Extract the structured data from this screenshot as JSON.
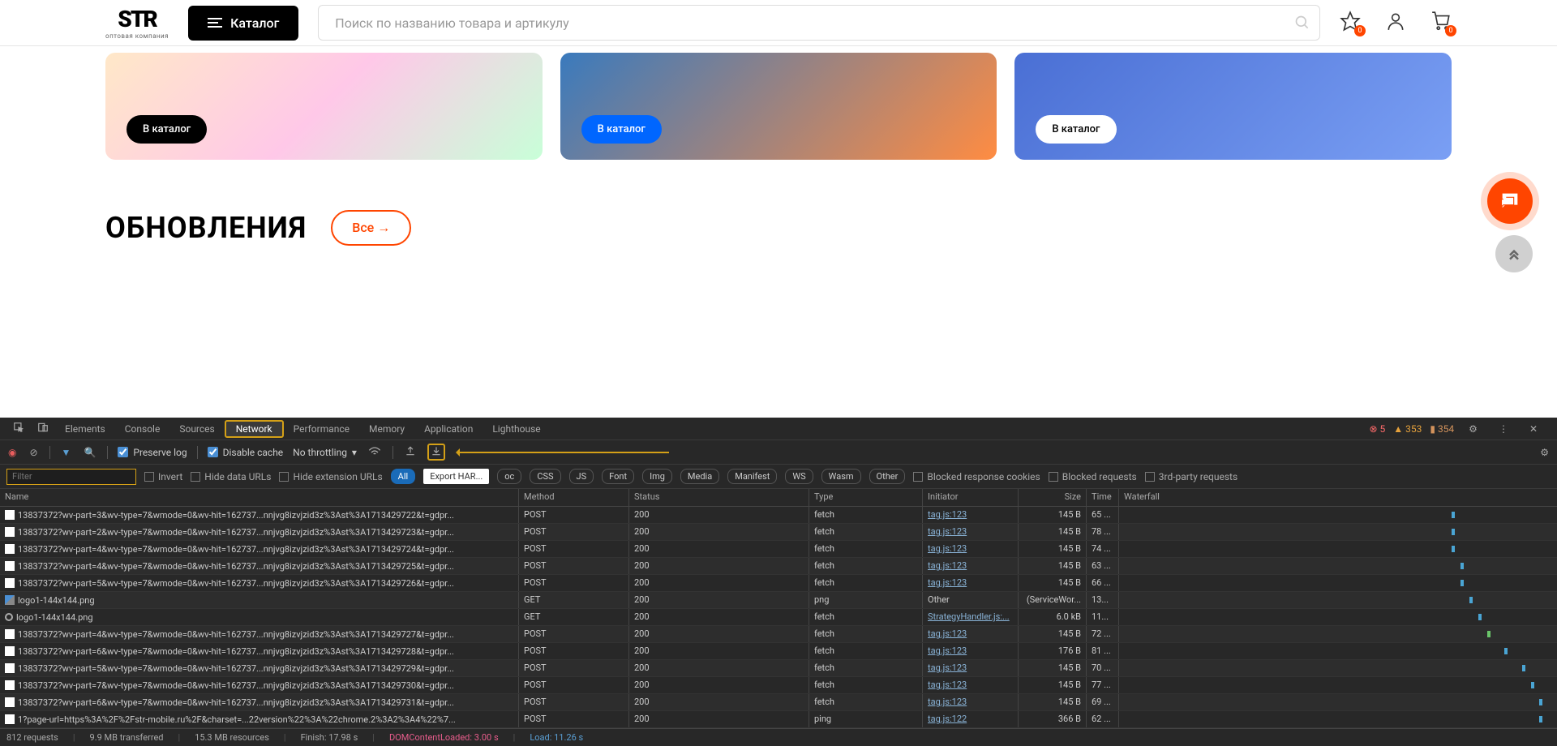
{
  "header": {
    "logo_main": "STR",
    "logo_sub": "оптовая компания",
    "catalog_btn": "Каталог",
    "search_placeholder": "Поиск по названию товара и артикулу",
    "fav_badge": "0",
    "cart_badge": "0"
  },
  "banners": [
    {
      "btn": "В каталог"
    },
    {
      "btn": "В каталог"
    },
    {
      "btn": "В каталог"
    }
  ],
  "section": {
    "title": "ОБНОВЛЕНИЯ",
    "all_btn": "Все →"
  },
  "devtools": {
    "tabs": [
      "Elements",
      "Console",
      "Sources",
      "Network",
      "Performance",
      "Memory",
      "Application",
      "Lighthouse"
    ],
    "active_tab": "Network",
    "errors": "5",
    "warnings": "353",
    "issues": "354",
    "toolbar": {
      "preserve_log": "Preserve log",
      "disable_cache": "Disable cache",
      "throttling": "No throttling"
    },
    "export_tooltip": "Export HAR...",
    "filter": {
      "placeholder": "Filter",
      "invert": "Invert",
      "hide_data": "Hide data URLs",
      "hide_ext": "Hide extension URLs",
      "chips": [
        "All",
        "oc",
        "CSS",
        "JS",
        "Font",
        "Img",
        "Media",
        "Manifest",
        "WS",
        "Wasm",
        "Other"
      ],
      "blocked_cookies": "Blocked response cookies",
      "blocked_requests": "Blocked requests",
      "third_party": "3rd-party requests"
    },
    "headers": {
      "name": "Name",
      "method": "Method",
      "status": "Status",
      "type": "Type",
      "initiator": "Initiator",
      "size": "Size",
      "time": "Time",
      "waterfall": "Waterfall"
    },
    "rows": [
      {
        "icon": "doc",
        "name": "13837372?wv-part=3&wv-type=7&wmode=0&wv-hit=162737...nnjvg8izvjzid3z%3Ast%3A1713429722&t=gdpr...",
        "method": "POST",
        "status": "200",
        "type": "fetch",
        "initiator": "tag.js:123",
        "initiator_link": true,
        "size": "145 B",
        "time": "65 ...",
        "wf": "at-76"
      },
      {
        "icon": "doc",
        "name": "13837372?wv-part=2&wv-type=7&wmode=0&wv-hit=162737...nnjvg8izvjzid3z%3Ast%3A1713429723&t=gdpr...",
        "method": "POST",
        "status": "200",
        "type": "fetch",
        "initiator": "tag.js:123",
        "initiator_link": true,
        "size": "145 B",
        "time": "78 ...",
        "wf": "at-76"
      },
      {
        "icon": "doc",
        "name": "13837372?wv-part=4&wv-type=7&wmode=0&wv-hit=162737...nnjvg8izvjzid3z%3Ast%3A1713429724&t=gdpr...",
        "method": "POST",
        "status": "200",
        "type": "fetch",
        "initiator": "tag.js:123",
        "initiator_link": true,
        "size": "145 B",
        "time": "74 ...",
        "wf": "at-76"
      },
      {
        "icon": "doc",
        "name": "13837372?wv-part=4&wv-type=7&wmode=0&wv-hit=162737...nnjvg8izvjzid3z%3Ast%3A1713429725&t=gdpr...",
        "method": "POST",
        "status": "200",
        "type": "fetch",
        "initiator": "tag.js:123",
        "initiator_link": true,
        "size": "145 B",
        "time": "63 ...",
        "wf": "at-78"
      },
      {
        "icon": "doc",
        "name": "13837372?wv-part=5&wv-type=7&wmode=0&wv-hit=162737...nnjvg8izvjzid3z%3Ast%3A1713429726&t=gdpr...",
        "method": "POST",
        "status": "200",
        "type": "fetch",
        "initiator": "tag.js:123",
        "initiator_link": true,
        "size": "145 B",
        "time": "66 ...",
        "wf": "at-78"
      },
      {
        "icon": "img",
        "name": "logo1-144x144.png",
        "method": "GET",
        "status": "200",
        "type": "png",
        "initiator": "Other",
        "initiator_link": false,
        "size": "(ServiceWor...",
        "time": "13...",
        "wf": "at-80"
      },
      {
        "icon": "gear",
        "name": "logo1-144x144.png",
        "method": "GET",
        "status": "200",
        "type": "fetch",
        "initiator": "StrategyHandler.js:...",
        "initiator_link": true,
        "size": "6.0 kB",
        "time": "11...",
        "wf": "at-82"
      },
      {
        "icon": "doc",
        "name": "13837372?wv-part=4&wv-type=7&wmode=0&wv-hit=162737...nnjvg8izvjzid3z%3Ast%3A1713429727&t=gdpr...",
        "method": "POST",
        "status": "200",
        "type": "fetch",
        "initiator": "tag.js:123",
        "initiator_link": true,
        "size": "145 B",
        "time": "72 ...",
        "wf": "at-84"
      },
      {
        "icon": "doc",
        "name": "13837372?wv-part=6&wv-type=7&wmode=0&wv-hit=162737...nnjvg8izvjzid3z%3Ast%3A1713429728&t=gdpr...",
        "method": "POST",
        "status": "200",
        "type": "fetch",
        "initiator": "tag.js:123",
        "initiator_link": true,
        "size": "176 B",
        "time": "81 ...",
        "wf": "at-88"
      },
      {
        "icon": "doc",
        "name": "13837372?wv-part=5&wv-type=7&wmode=0&wv-hit=162737...nnjvg8izvjzid3z%3Ast%3A1713429729&t=gdpr...",
        "method": "POST",
        "status": "200",
        "type": "fetch",
        "initiator": "tag.js:123",
        "initiator_link": true,
        "size": "145 B",
        "time": "70 ...",
        "wf": "at-92"
      },
      {
        "icon": "doc",
        "name": "13837372?wv-part=7&wv-type=7&wmode=0&wv-hit=162737...nnjvg8izvjzid3z%3Ast%3A1713429730&t=gdpr...",
        "method": "POST",
        "status": "200",
        "type": "fetch",
        "initiator": "tag.js:123",
        "initiator_link": true,
        "size": "145 B",
        "time": "77 ...",
        "wf": "at-94"
      },
      {
        "icon": "doc",
        "name": "13837372?wv-part=6&wv-type=7&wmode=0&wv-hit=162737...nnjvg8izvjzid3z%3Ast%3A1713429731&t=gdpr...",
        "method": "POST",
        "status": "200",
        "type": "fetch",
        "initiator": "tag.js:123",
        "initiator_link": true,
        "size": "145 B",
        "time": "69 ...",
        "wf": "at-96"
      },
      {
        "icon": "doc",
        "name": "1?page-url=https%3A%2F%2Fstr-mobile.ru%2F&charset=...22version%22%3A%22chrome.2%3A2%3A4%22%7...",
        "method": "POST",
        "status": "200",
        "type": "ping",
        "initiator": "tag.js:122",
        "initiator_link": true,
        "size": "366 B",
        "time": "62 ...",
        "wf": "at-96"
      }
    ],
    "footer": {
      "requests": "812 requests",
      "transferred": "9.9 MB transferred",
      "resources": "15.3 MB resources",
      "finish": "Finish: 17.98 s",
      "dcl_label": "DOMContentLoaded:",
      "dcl_value": "3.00 s",
      "load_label": "Load:",
      "load_value": "11.26 s"
    }
  }
}
